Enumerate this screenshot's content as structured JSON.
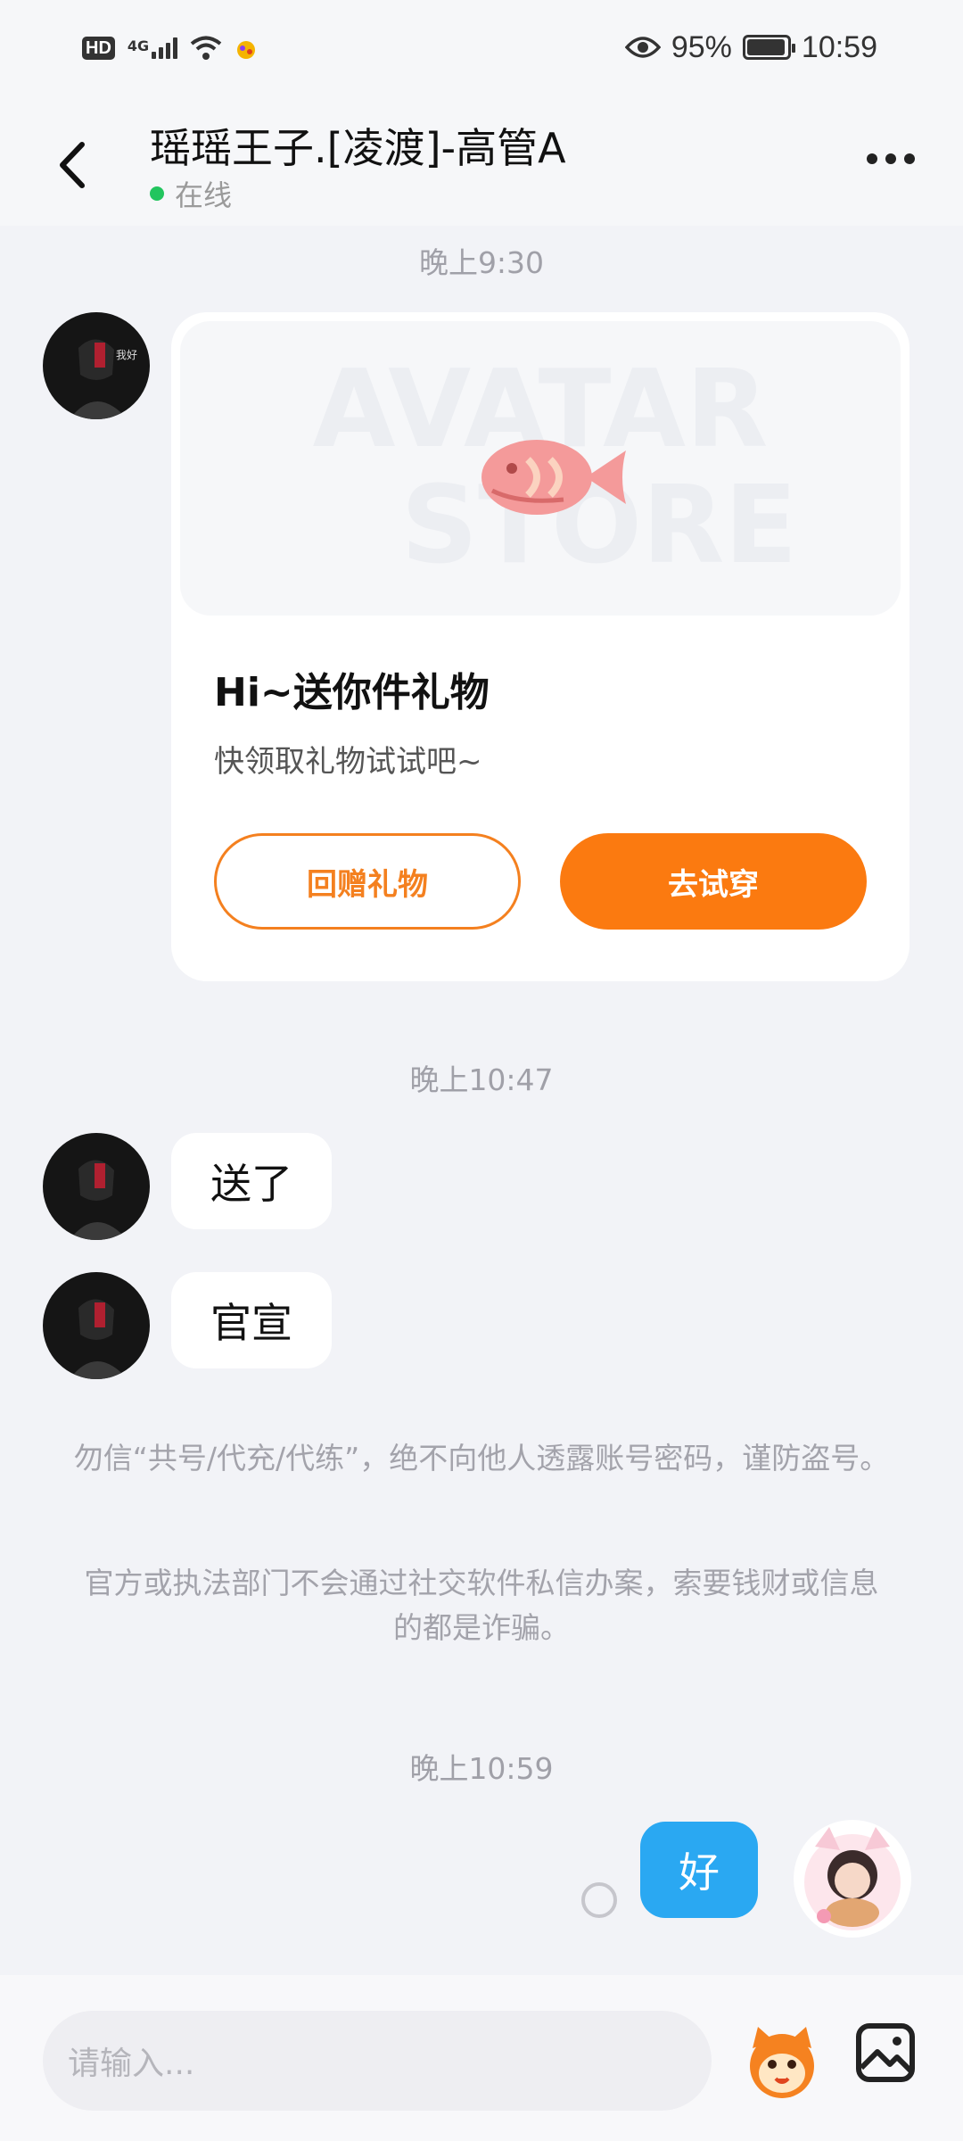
{
  "status_bar": {
    "hd": "HD",
    "network": "4G",
    "battery": "95%",
    "battery_level": 0.95,
    "time": "10:59"
  },
  "header": {
    "title": "瑶瑶王子.[凌渡]-高管A",
    "status": "在线"
  },
  "chat": {
    "ts1": "晚上9:30",
    "gift_card": {
      "title": "Hi~送你件礼物",
      "subtitle": "快领取礼物试试吧~",
      "return_gift": "回赠礼物",
      "try_on": "去试穿",
      "watermark_1": "AVATAR",
      "watermark_2": "STORE"
    },
    "ts2": "晚上10:47",
    "msg1": "送了",
    "msg2": "官宣",
    "notice1": "勿信“共号/代充/代练”，绝不向他人透露账号密码，谨防盗号。",
    "notice2": "官方或执法部门不会通过社交软件私信办案，索要钱财或信息的都是诈骗。",
    "ts3": "晚上10:59",
    "my_msg": "好"
  },
  "input": {
    "placeholder": "请输入..."
  },
  "colors": {
    "accent_orange": "#fb7a10",
    "my_bubble": "#2aa8f2",
    "online": "#22c55e"
  }
}
